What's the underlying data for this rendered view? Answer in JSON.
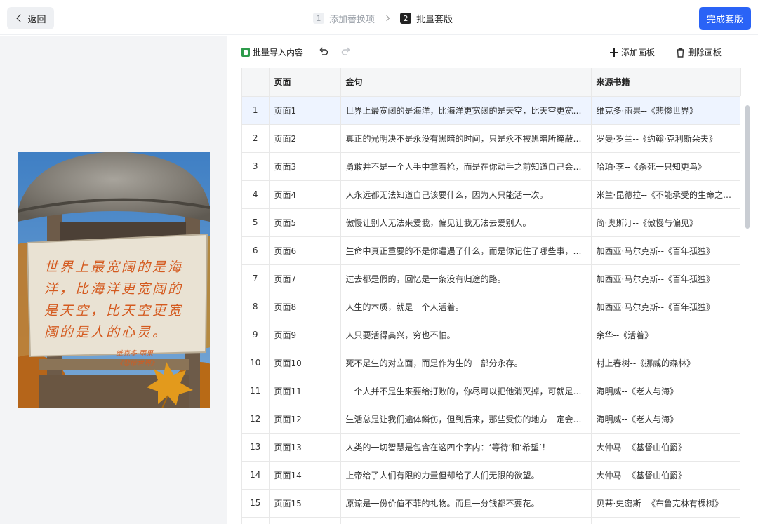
{
  "header": {
    "back_label": "返回",
    "steps": [
      {
        "num": "1",
        "label": "添加替换项"
      },
      {
        "num": "2",
        "label": "批量套版"
      }
    ],
    "finish_label": "完成套版"
  },
  "preview": {
    "poem_lines": [
      "世界上最宽阔的是海",
      "洋，比海洋更宽阔的",
      "是天空，比天空更宽",
      "阔的是人的心灵。"
    ],
    "signature_lines": [
      "维克多·雨果",
      "《悲惨世界》"
    ]
  },
  "toolbar": {
    "import_label": "批量导入内容",
    "add_label": "添加画板",
    "delete_label": "删除画板"
  },
  "table": {
    "headers": [
      "",
      "页面",
      "金句",
      "来源书籍"
    ],
    "rows": [
      {
        "idx": "1",
        "page": "页面1",
        "quote": "世界上最宽阔的是海洋，比海洋更宽阔的是天空，比天空更宽阔...",
        "source": "维克多·雨果--《悲惨世界》"
      },
      {
        "idx": "2",
        "page": "页面2",
        "quote": "真正的光明决不是永没有黑暗的时间，只是永不被黑暗所掩蔽罢...",
        "source": "罗曼·罗兰--《约翰·克利斯朵夫》"
      },
      {
        "idx": "3",
        "page": "页面3",
        "quote": "勇敢并不是一个人手中拿着枪，而是在你动手之前知道自己会输...",
        "source": "哈珀·李--《杀死一只知更鸟》"
      },
      {
        "idx": "4",
        "page": "页面4",
        "quote": "人永远都无法知道自己该要什么，因为人只能活一次。",
        "source": "米兰·昆德拉--《不能承受的生命之轻..."
      },
      {
        "idx": "5",
        "page": "页面5",
        "quote": "傲慢让别人无法来爱我，偏见让我无法去爱别人。",
        "source": "简·奥斯汀--《傲慢与偏见》"
      },
      {
        "idx": "6",
        "page": "页面6",
        "quote": "生命中真正重要的不是你遭遇了什么，而是你记住了哪些事，又...",
        "source": "加西亚·马尔克斯--《百年孤独》"
      },
      {
        "idx": "7",
        "page": "页面7",
        "quote": "过去都是假的，回忆是一条没有归途的路。",
        "source": "加西亚·马尔克斯--《百年孤独》"
      },
      {
        "idx": "8",
        "page": "页面8",
        "quote": "人生的本质，就是一个人活着。",
        "source": "加西亚·马尔克斯--《百年孤独》"
      },
      {
        "idx": "9",
        "page": "页面9",
        "quote": "人只要活得高兴，穷也不怕。",
        "source": "余华--《活着》"
      },
      {
        "idx": "10",
        "page": "页面10",
        "quote": "死不是生的对立面，而是作为生的一部分永存。",
        "source": "村上春树--《挪威的森林》"
      },
      {
        "idx": "11",
        "page": "页面11",
        "quote": "一个人并不是生来要给打败的，你尽可以把他消灭掉，可就是打...",
        "source": "海明威--《老人与海》"
      },
      {
        "idx": "12",
        "page": "页面12",
        "quote": "生活总是让我们遍体鳞伤，但到后来，那些受伤的地方一定会变...",
        "source": "海明威--《老人与海》"
      },
      {
        "idx": "13",
        "page": "页面13",
        "quote": "人类的一切智慧是包含在这四个字内：‘等待’和‘希望’！",
        "source": "大仲马--《基督山伯爵》"
      },
      {
        "idx": "14",
        "page": "页面14",
        "quote": "上帝给了人们有限的力量但却给了人们无限的欲望。",
        "source": "大仲马--《基督山伯爵》"
      },
      {
        "idx": "15",
        "page": "页面15",
        "quote": "原谅是一份价值不菲的礼物。而且一分钱都不要花。",
        "source": "贝蒂·史密斯--《布鲁克林有棵树》"
      },
      {
        "idx": "",
        "page": "",
        "quote": "",
        "source": ""
      }
    ]
  }
}
